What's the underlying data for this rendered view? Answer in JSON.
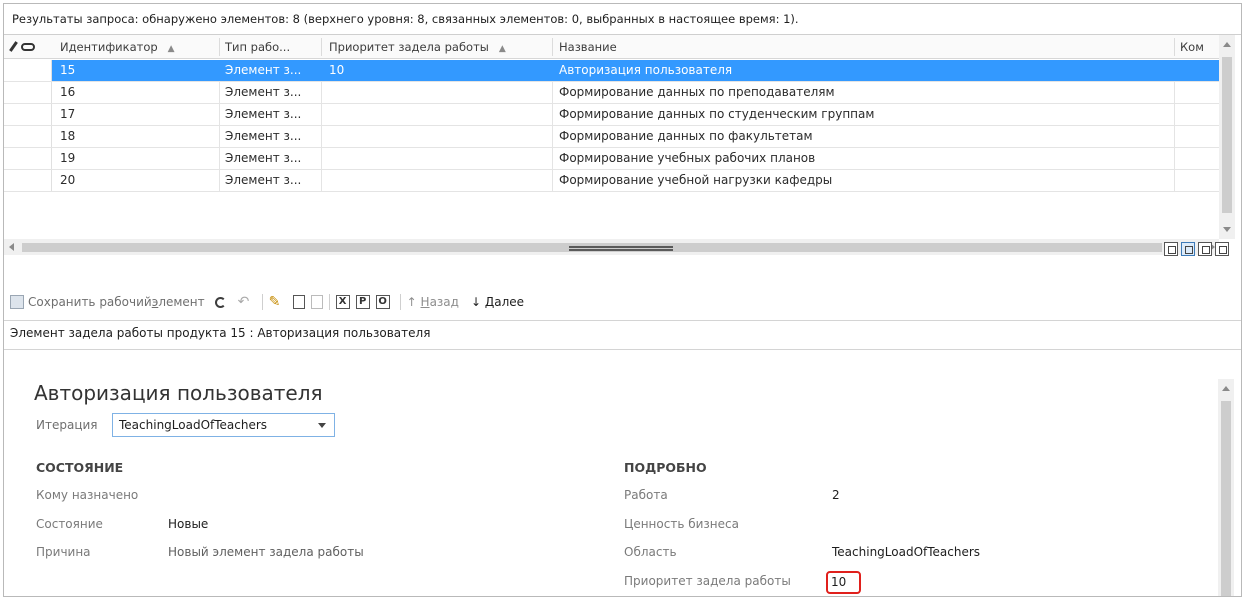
{
  "summary": "Результаты запроса: обнаружено элементов: 8 (верхнего уровня: 8, связанных элементов: 0, выбранных в настоящее время: 1).",
  "grid": {
    "columns": {
      "id": "Идентификатор",
      "type": "Тип рабо...",
      "priority": "Приоритет задела работы",
      "title": "Название",
      "comment": "Ком"
    },
    "rows": [
      {
        "id": "15",
        "type": "Элемент з...",
        "priority": "10",
        "title": "Авторизация пользователя"
      },
      {
        "id": "16",
        "type": "Элемент з...",
        "priority": "",
        "title": "Формирование данных по преподавателям"
      },
      {
        "id": "17",
        "type": "Элемент з...",
        "priority": "",
        "title": "Формирование данных по студенческим группам"
      },
      {
        "id": "18",
        "type": "Элемент з...",
        "priority": "",
        "title": "Формирование данных по факультетам"
      },
      {
        "id": "19",
        "type": "Элемент з...",
        "priority": "",
        "title": "Формирование учебных рабочих планов"
      },
      {
        "id": "20",
        "type": "Элемент з...",
        "priority": "",
        "title": "Формирование учебной нагрузки кафедры"
      }
    ]
  },
  "toolbar": {
    "save_prefix": "Сохранить рабочий ",
    "save_underlined": "э",
    "save_suffix": "лемент",
    "btn_x": "X",
    "btn_p": "P",
    "btn_o": "O",
    "back_arrow": "↑",
    "back_underlined": "Н",
    "back_rest": "азад",
    "next_arrow": "↓",
    "next_underlined": "Д",
    "next_rest": "алее"
  },
  "caption": "Элемент задела работы продукта 15 : Авторизация пользователя",
  "form": {
    "title": "Авторизация пользователя",
    "iteration_label": "Итерация",
    "iteration_value": "TeachingLoadOfTeachers",
    "status": {
      "heading": "СОСТОЯНИЕ",
      "assigned_label": "Кому назначено",
      "state_label": "Состояние",
      "state_value": "Новые",
      "reason_label": "Причина",
      "reason_value": "Новый элемент задела работы"
    },
    "details": {
      "heading": "ПОДРОБНО",
      "work_label": "Работа",
      "work_value": "2",
      "business_label": "Ценность бизнеса",
      "area_label": "Область",
      "area_value": "TeachingLoadOfTeachers",
      "priority_label": "Приоритет задела работы",
      "priority_value": "10"
    }
  },
  "colors": {
    "selection": "#3399ff",
    "highlight_box": "#e0201c",
    "combo_border": "#7fb2e5"
  }
}
